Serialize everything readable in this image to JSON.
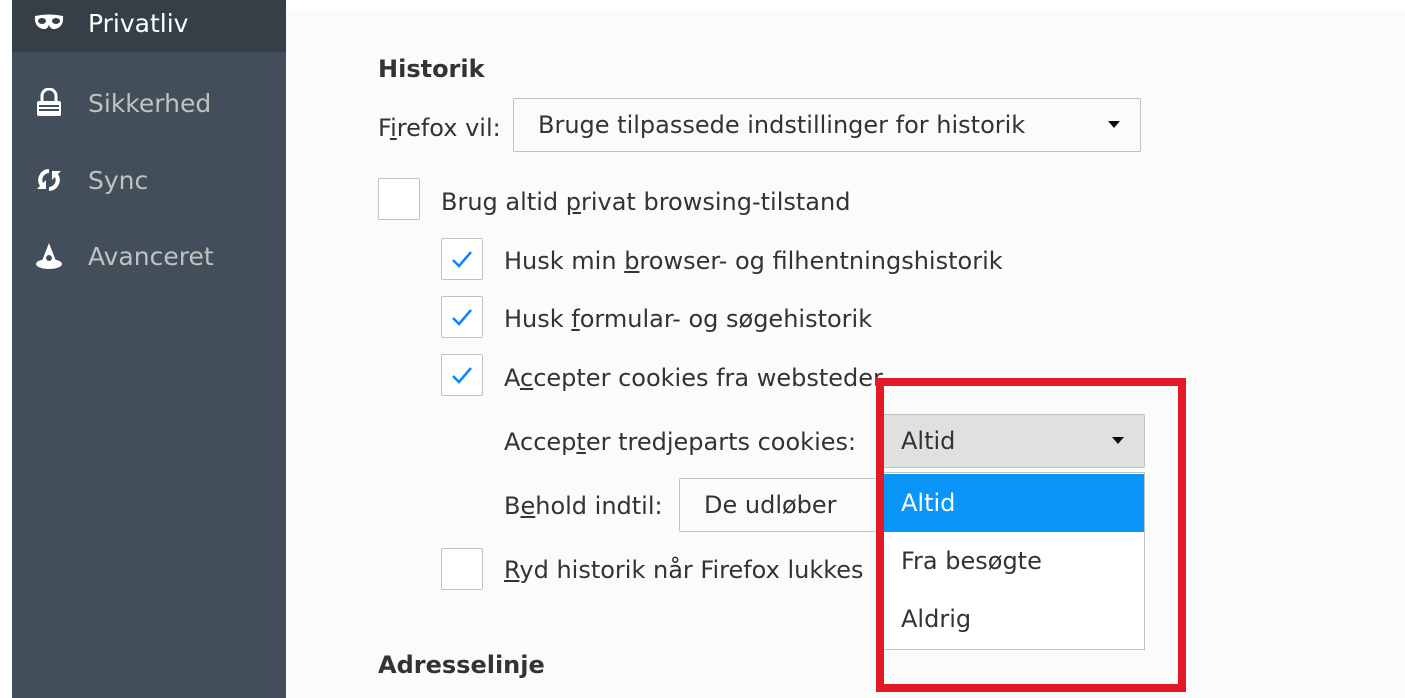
{
  "sidebar": {
    "items": [
      {
        "label": "Privatliv",
        "icon": "mask-icon",
        "selected": true
      },
      {
        "label": "Sikkerhed",
        "icon": "lock-icon",
        "selected": false
      },
      {
        "label": "Sync",
        "icon": "sync-icon",
        "selected": false
      },
      {
        "label": "Avanceret",
        "icon": "wizard-hat-icon",
        "selected": false
      }
    ]
  },
  "history": {
    "heading": "Historik",
    "firefox_will": {
      "label_prefix": "F",
      "label_ul": "i",
      "label_rest": "refox vil:",
      "value": "Bruge tilpassede indstillinger for historik"
    },
    "private_mode": {
      "pre": "Brug altid ",
      "ul": "p",
      "post": "rivat browsing-tilstand",
      "checked": false
    },
    "browser_history": {
      "pre": "Husk min ",
      "ul": "b",
      "post": "rowser- og filhentningshistorik",
      "checked": true
    },
    "form_history": {
      "pre": "Husk ",
      "ul": "f",
      "post": "ormular- og søgehistorik",
      "checked": true
    },
    "accept_cookies": {
      "pre": "A",
      "ul": "c",
      "post": "cepter cookies fra websteder",
      "checked": true
    },
    "third_party": {
      "pre": "Accep",
      "ul": "t",
      "post": "er tredjeparts cookies:",
      "value": "Altid"
    },
    "keep_until": {
      "pre": "B",
      "ul": "e",
      "post": "hold indtil:",
      "value": "De udløber"
    },
    "clear_on_close": {
      "ul": "R",
      "post": "yd historik når Firefox lukkes",
      "checked": false
    }
  },
  "dropdown": {
    "options": [
      "Altid",
      "Fra besøgte",
      "Aldrig"
    ],
    "selected": "Altid"
  },
  "address_bar": {
    "heading": "Adresselinje"
  },
  "colors": {
    "highlight": "#e21a25",
    "accent": "#0996f8",
    "checkmark": "#0a84ff"
  }
}
